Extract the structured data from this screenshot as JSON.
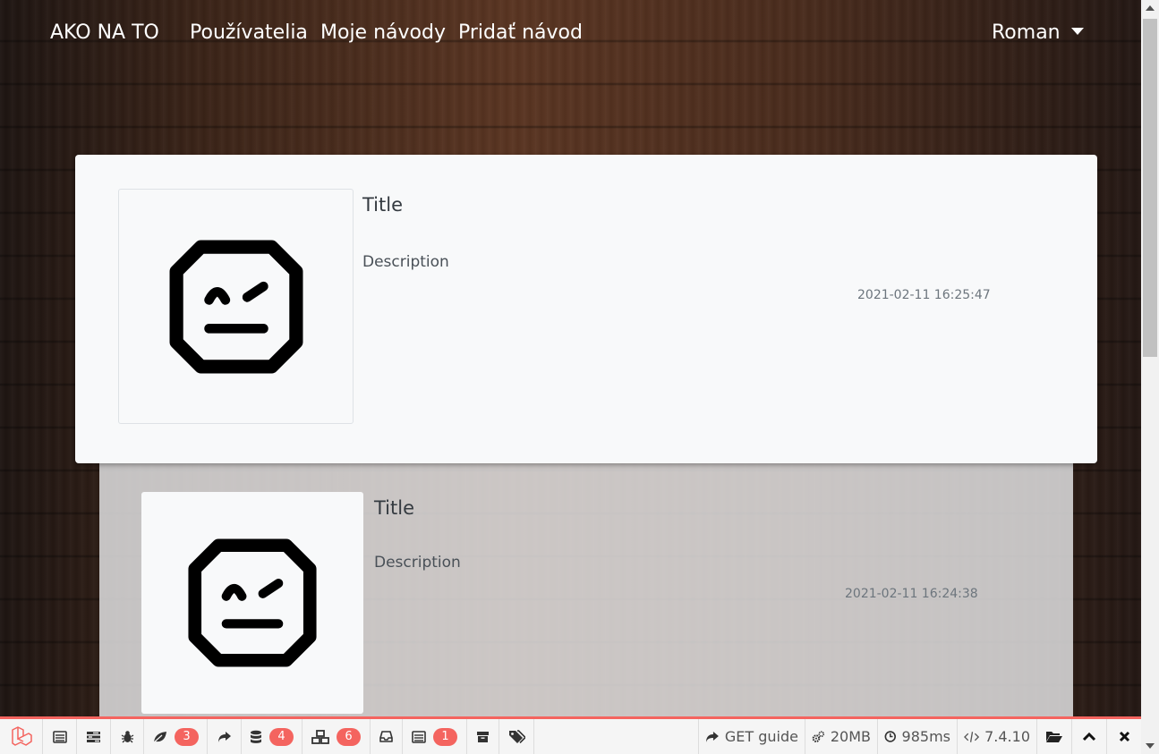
{
  "navbar": {
    "brand": "AKO NA TO",
    "links": [
      "Používatelia",
      "Moje návody",
      "Pridať návod"
    ],
    "user": "Roman"
  },
  "posts": [
    {
      "title": "Title",
      "description": "Description",
      "date": "2021-02-11 16:25:47"
    },
    {
      "title": "Title",
      "description": "Description",
      "date": "2021-02-11 16:24:38"
    }
  ],
  "debugbar": {
    "accent_color": "#f4645f",
    "tabs": [
      {
        "icon": "laravel-logo-icon"
      },
      {
        "icon": "messages-icon"
      },
      {
        "icon": "timeline-icon"
      },
      {
        "icon": "bug-icon"
      },
      {
        "icon": "leaf-icon",
        "badge": "3"
      },
      {
        "icon": "share-icon"
      },
      {
        "icon": "database-icon",
        "badge": "4"
      },
      {
        "icon": "cubes-icon",
        "badge": "6"
      },
      {
        "icon": "inbox-icon"
      },
      {
        "icon": "list-icon",
        "badge": "1"
      },
      {
        "icon": "archive-icon"
      },
      {
        "icon": "tags-icon"
      }
    ],
    "route": "GET guide",
    "memory": "20MB",
    "time": "985ms",
    "php_version": "7.4.10"
  }
}
